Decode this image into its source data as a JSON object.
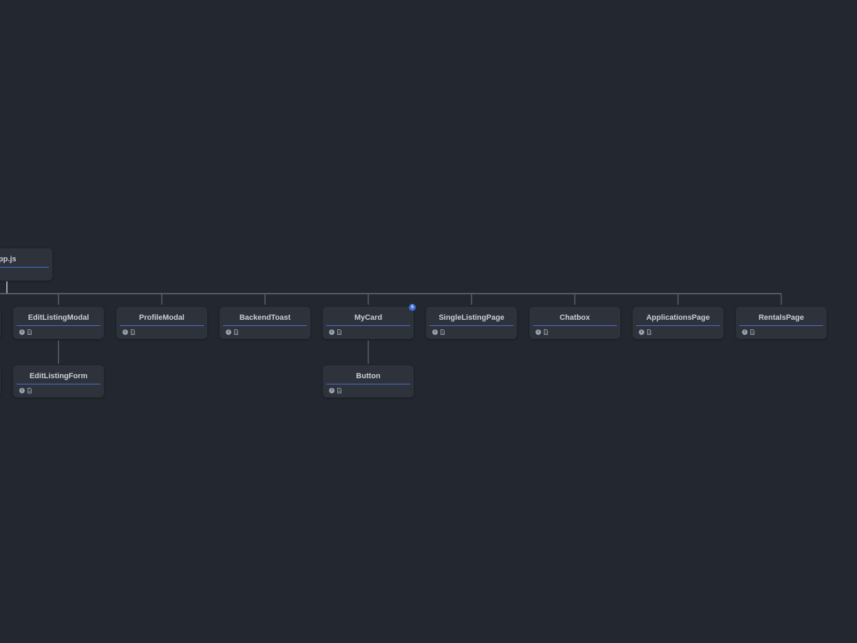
{
  "root": {
    "label": "App.js"
  },
  "components": [
    {
      "label": "EditListingModal"
    },
    {
      "label": "ProfileModal"
    },
    {
      "label": "BackendToast"
    },
    {
      "label": "MyCard",
      "badge": "5"
    },
    {
      "label": "SingleListingPage"
    },
    {
      "label": "Chatbox"
    },
    {
      "label": "ApplicationsPage"
    },
    {
      "label": "RentalsPage"
    }
  ],
  "children": [
    {
      "label": "EditListingForm",
      "parent": "EditListingModal"
    },
    {
      "label": "Button",
      "parent": "MyCard"
    }
  ],
  "icons": {
    "info": "info-icon",
    "file": "file-icon"
  },
  "colors": {
    "background": "#23272f",
    "node": "#2e323b",
    "accent": "#4b6ed6",
    "edge": "#5b606a",
    "badge": "#3f6fd8"
  }
}
